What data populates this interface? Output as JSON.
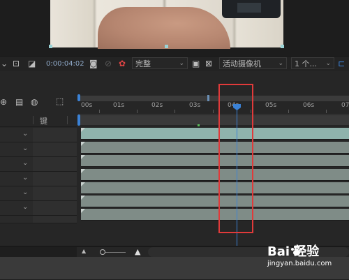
{
  "toolbar": {
    "timecode": "0:00:04:02",
    "resolution": "完整",
    "camera": "活动摄像机",
    "views": "1 个..."
  },
  "timeline": {
    "ruler_labels": [
      "00s",
      "01s",
      "02s",
      "03s",
      "04s",
      "05s",
      "06s",
      "07"
    ],
    "column_header_key": "键",
    "layer_count": 7,
    "playhead_time": "04s",
    "colors": {
      "accent": "#3b82d6",
      "layer_first": "#8fb3ac",
      "layer": "#7f8c87",
      "highlight": "#e03a3a"
    }
  },
  "watermark": {
    "logo": "Bai 经验",
    "url": "jingyan.baidu.com"
  }
}
